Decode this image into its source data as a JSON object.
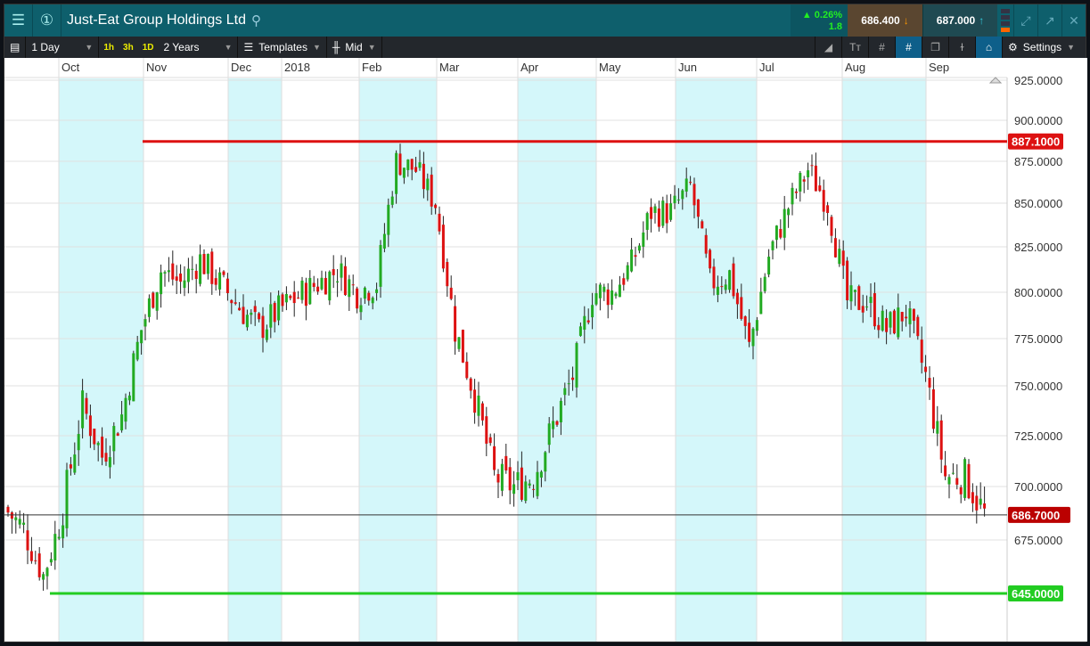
{
  "header": {
    "title": "Just-Eat Group Holdings Ltd",
    "change_pct": "▲ 0.26%",
    "change_abs": "1.8",
    "sell": "686.400",
    "buy": "687.000"
  },
  "toolbar": {
    "interval": "1 Day",
    "quick": [
      "1h",
      "3h",
      "1D"
    ],
    "range": "2 Years",
    "templates": "Templates",
    "price_type": "Mid",
    "settings": "Settings"
  },
  "colors": {
    "up": "#22aa22",
    "down": "#dd1111",
    "band": "#d4f7fa",
    "resistance": "#dd1111",
    "support": "#22cc22"
  },
  "chart_data": {
    "type": "candlestick",
    "months": [
      "Oct",
      "Nov",
      "Dec",
      "2018",
      "Feb",
      "Mar",
      "Apr",
      "May",
      "Jun",
      "Jul",
      "Aug",
      "Sep"
    ],
    "yticks": [
      "925.0000",
      "900.0000",
      "875.0000",
      "850.0000",
      "825.0000",
      "800.0000",
      "775.0000",
      "750.0000",
      "725.0000",
      "700.0000",
      "675.0000"
    ],
    "weekly_closes": [
      690,
      680,
      655,
      690,
      740,
      715,
      735,
      780,
      812,
      805,
      818,
      805,
      792,
      780,
      790,
      798,
      805,
      812,
      800,
      805,
      875,
      870,
      850,
      780,
      745,
      705,
      700,
      705,
      730,
      755,
      800,
      800,
      815,
      845,
      845,
      860,
      805,
      810,
      770,
      820,
      848,
      870,
      850,
      795,
      795,
      780,
      790,
      755,
      705,
      705,
      687
    ],
    "resistance": {
      "value": 887.1,
      "label": "887.1000"
    },
    "support": {
      "value": 645,
      "label": "645.0000"
    },
    "current": {
      "value": 686.7,
      "label": "686.7000"
    }
  }
}
